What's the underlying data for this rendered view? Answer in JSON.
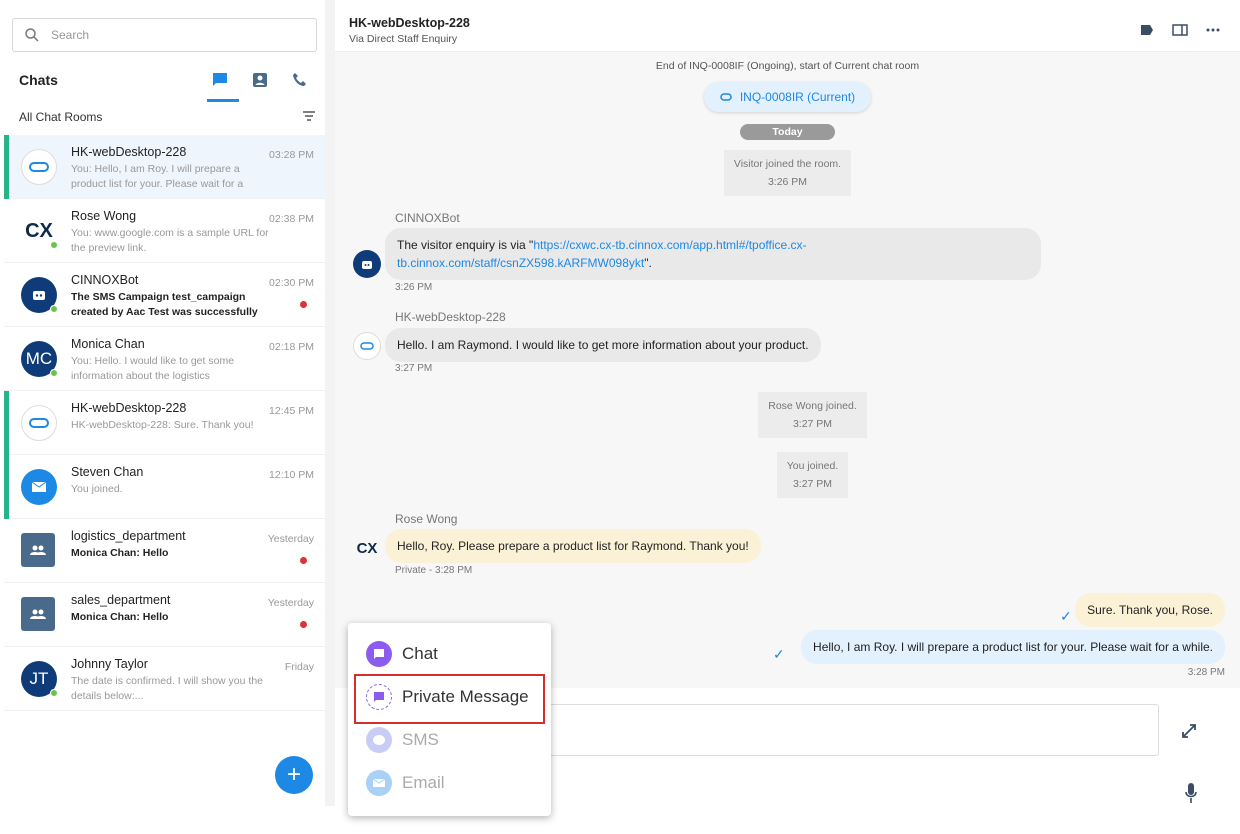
{
  "sidebar": {
    "search_placeholder": "Search",
    "chats_title": "Chats",
    "filter_label": "All Chat Rooms",
    "items": [
      {
        "name": "HK-webDesktop-228",
        "preview": "You: Hello, I am Roy. I will prepare a product list for your. Please wait for a while.",
        "time": "03:28 PM",
        "avatar": "link",
        "selected": true,
        "bar": true
      },
      {
        "name": "Rose Wong",
        "preview": "You: www.google.com is a sample URL for the preview link.",
        "time": "02:38 PM",
        "avatar": "CX"
      },
      {
        "name": "CINNOXBot",
        "preview": "The SMS Campaign test_campaign created by Aac Test was successfully execut...",
        "time": "02:30 PM",
        "avatar": "bot",
        "unread": true
      },
      {
        "name": "Monica Chan",
        "preview": "You: Hello. I would like to get some information about the logistics arrangement ...",
        "time": "02:18 PM",
        "avatar": "MC"
      },
      {
        "name": "HK-webDesktop-228",
        "preview": "HK-webDesktop-228: Sure. Thank you!",
        "time": "12:45 PM",
        "avatar": "link",
        "bar": true
      },
      {
        "name": "Steven Chan",
        "preview": "You joined.",
        "time": "12:10 PM",
        "avatar": "mail",
        "bar": true
      },
      {
        "name": "logistics_department",
        "preview": "Monica Chan: Hello",
        "time": "Yesterday",
        "avatar": "group",
        "unread": true
      },
      {
        "name": "sales_department",
        "preview": "Monica Chan: Hello",
        "time": "Yesterday",
        "avatar": "group",
        "unread": true
      },
      {
        "name": "Johnny Taylor",
        "preview": "The date is confirmed. I will show you the details below:...",
        "time": "Friday",
        "avatar": "JT"
      }
    ]
  },
  "header": {
    "title": "HK-webDesktop-228",
    "subtitle": "Via Direct Staff Enquiry"
  },
  "messages": {
    "end_notice": "End of INQ-0008IF (Ongoing), start of Current chat room",
    "inq_link": "INQ-0008IR (Current)",
    "date_sep": "Today",
    "visitor_joined": "Visitor joined the room.",
    "visitor_joined_time": "3:26 PM",
    "bot_sender": "CINNOXBot",
    "bot_text_pre": "The visitor enquiry is via \"",
    "bot_link": "https://cxwc.cx-tb.cinnox.com/app.html#/tpoffice.cx-tb.cinnox.com/staff/csnZX598.kARFMW098ykt",
    "bot_text_post": "\".",
    "bot_time": "3:26 PM",
    "visitor_sender": "HK-webDesktop-228",
    "visitor_text": "Hello. I am Raymond. I would like to get more information about your product.",
    "visitor_time": "3:27 PM",
    "rose_joined": "Rose Wong joined.",
    "rose_joined_time": "3:27 PM",
    "you_joined": "You joined.",
    "you_joined_time": "3:27 PM",
    "rose_sender": "Rose Wong",
    "rose_text": "Hello, Roy. Please prepare a product list for Raymond. Thank you!",
    "rose_time": "Private - 3:28 PM",
    "my_private": "Sure. Thank you, Rose.",
    "my_text": "Hello, I am Roy. I will prepare a product list for your. Please wait for a while.",
    "my_time": "3:28 PM"
  },
  "menu": {
    "chat": "Chat",
    "private": "Private Message",
    "sms": "SMS",
    "email": "Email"
  },
  "colors": {
    "accent": "#1e88e5",
    "selected_bar": "#26b38a",
    "highlight": "#d32f2f",
    "menu_purple": "#8c5cf0"
  }
}
